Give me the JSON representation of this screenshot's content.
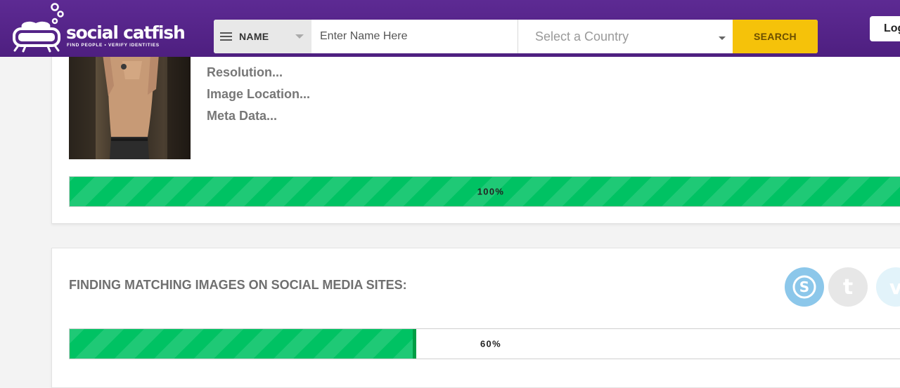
{
  "header": {
    "logo": {
      "name": "social catfish",
      "tagline": "FIND PEOPLE • VERIFY IDENTITIES"
    },
    "search": {
      "type_label": "NAME",
      "name_placeholder": "Enter Name Here",
      "country_label": "Select a Country",
      "search_label": "SEARCH"
    },
    "login_label": "Log"
  },
  "analysis": {
    "labels": [
      "Resolution...",
      "Image Location...",
      "Meta Data..."
    ],
    "progress": {
      "value": 100,
      "label": "100%"
    }
  },
  "social": {
    "title": "FINDING MATCHING IMAGES ON SOCIAL MEDIA SITES:",
    "icons": [
      "skype-icon",
      "tumblr-icon",
      "vimeo-icon"
    ],
    "progress": {
      "value": 60,
      "label": "60%"
    }
  },
  "colors": {
    "header": "#5a2990",
    "search_button": "#f5c20a",
    "progress": "#00c263",
    "skype": "#8cc7ea"
  }
}
